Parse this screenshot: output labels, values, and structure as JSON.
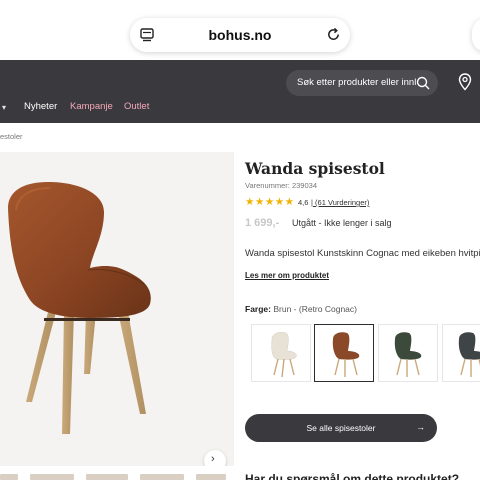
{
  "browser": {
    "url": "bohus.no"
  },
  "header": {
    "search_placeholder": "Søk etter produkter eller innl",
    "nav": [
      {
        "label": "Nyheter"
      },
      {
        "label": "Kampanje"
      },
      {
        "label": "Outlet"
      }
    ]
  },
  "breadcrumb": "estoler",
  "product": {
    "title": "Wanda spisestol",
    "sku": "Varenummer: 239034",
    "rating_value": "4.6",
    "rating_display": "4,6",
    "separator": "|",
    "review_link": "(61 Vurderinger)",
    "price": "1 699,-",
    "stock_status": "Utgått - Ikke lenger i salg",
    "description": "Wanda spisestol Kunstskinn Cognac med eikeben hvitpi",
    "read_more": "Les mer om produktet",
    "color_label_prefix": "Farge:",
    "color_label_value": "Brun - (Retro Cognac)",
    "swatches": [
      {
        "name": "cream",
        "color": "#e8e2d6",
        "selected": false
      },
      {
        "name": "cognac",
        "color": "#8a4a2a",
        "selected": true
      },
      {
        "name": "dark-green",
        "color": "#3b4a3a",
        "selected": false
      },
      {
        "name": "dark-grey",
        "color": "#3f4446",
        "selected": false
      }
    ],
    "cta_label": "Se alle spisestoler",
    "cta_arrow": "→",
    "next_section_heading": "Har du spørsmål om dette produktet?"
  },
  "colors": {
    "header_bg": "#3a393d",
    "accent_pink": "#f4a9b9",
    "star": "#f0b400",
    "cta_bg": "#3a393d"
  }
}
